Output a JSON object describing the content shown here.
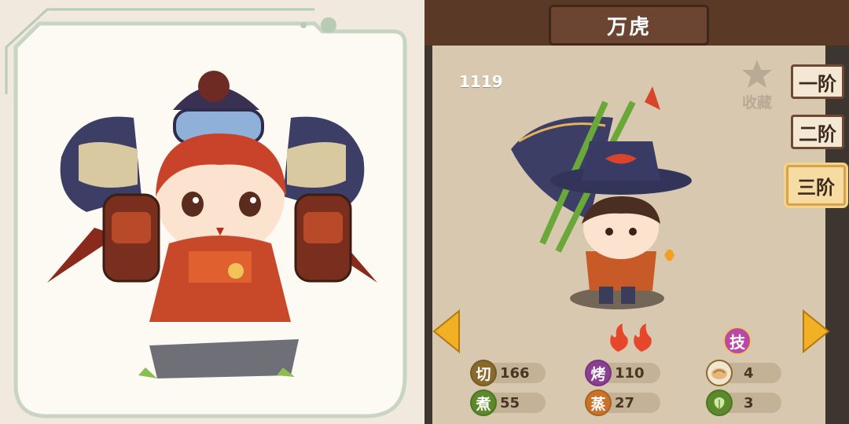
{
  "card": {
    "title": "万虎",
    "score": "1119",
    "favorite_label": "收藏",
    "tiers": [
      "一阶",
      "二阶",
      "三阶"
    ],
    "active_tier": "三阶",
    "skill_badge": "技",
    "stats": [
      {
        "char": "切",
        "value": "166",
        "color": "#8a6a2c"
      },
      {
        "char": "烤",
        "value": "110",
        "color": "#8a3f95"
      },
      {
        "char": "煮",
        "value": "55",
        "color": "#5c8a2a"
      },
      {
        "char": "蒸",
        "value": "27",
        "color": "#c9732a"
      },
      {
        "icon": "bun-ingredient-icon",
        "value": "4"
      },
      {
        "icon": "cabbage-ingredient-icon",
        "value": "3"
      }
    ],
    "flame_count": 2
  },
  "colors": {
    "accent_gold": "#f2b024",
    "wood": "#5a3a26",
    "parchment": "#d8c8af"
  }
}
